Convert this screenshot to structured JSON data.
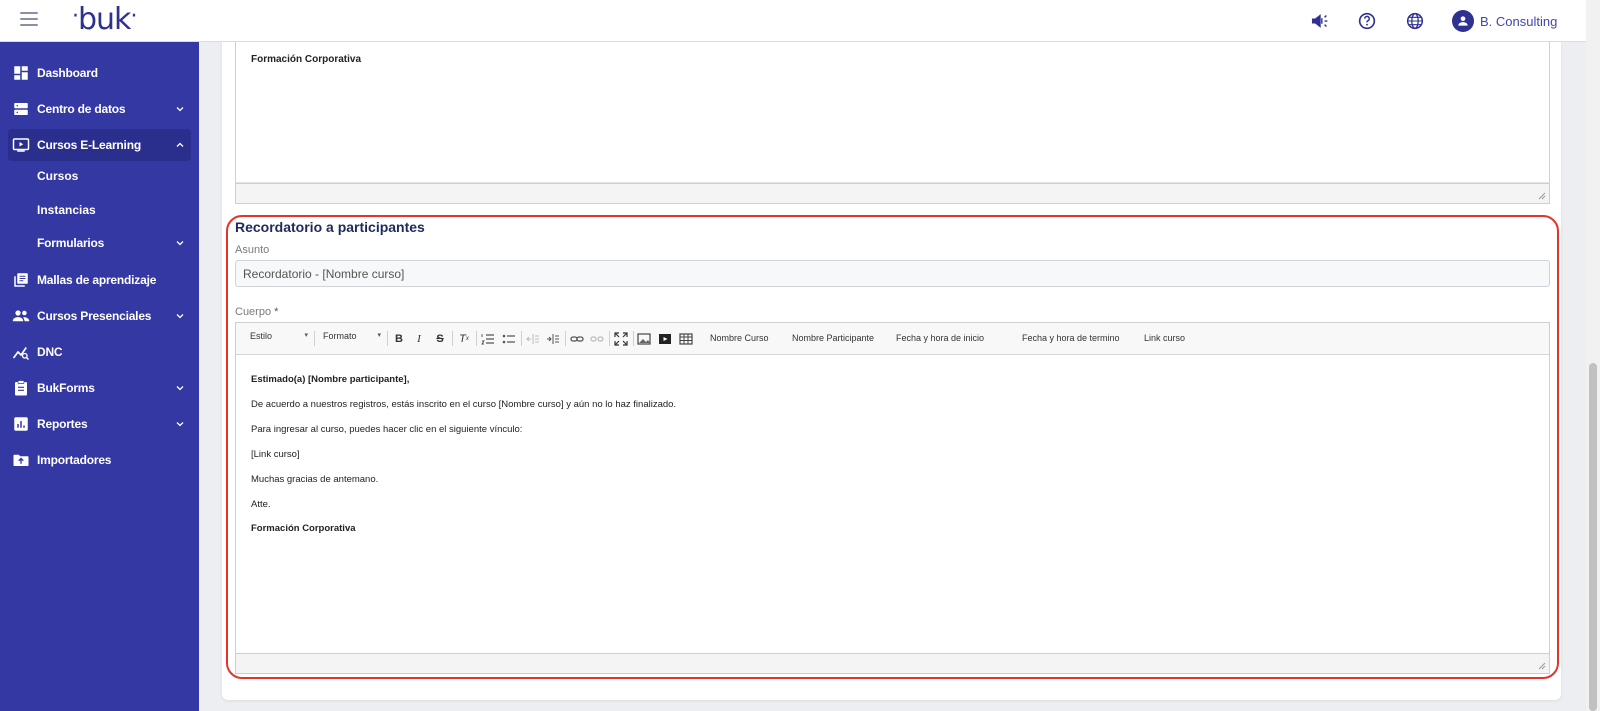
{
  "header": {
    "logo_text": "buk",
    "user_name": "B. Consulting",
    "icons": [
      "announcement-icon",
      "help-icon",
      "language-icon",
      "user-avatar-icon"
    ]
  },
  "sidebar": {
    "items": [
      {
        "label": "Dashboard",
        "icon": "dashboard-icon",
        "has_chevron": false
      },
      {
        "label": "Centro de datos",
        "icon": "database-icon",
        "has_chevron": true
      },
      {
        "label": "Cursos E-Learning",
        "icon": "video-icon",
        "has_chevron": true,
        "active": true
      },
      {
        "label": "Mallas de aprendizaje",
        "icon": "library-icon",
        "has_chevron": false
      },
      {
        "label": "Cursos Presenciales",
        "icon": "people-icon",
        "has_chevron": true
      },
      {
        "label": "DNC",
        "icon": "chart-line-icon",
        "has_chevron": false
      },
      {
        "label": "BukForms",
        "icon": "clipboard-icon",
        "has_chevron": true
      },
      {
        "label": "Reportes",
        "icon": "bar-chart-icon",
        "has_chevron": true
      },
      {
        "label": "Importadores",
        "icon": "folder-upload-icon",
        "has_chevron": false
      }
    ],
    "sub_items": [
      "Cursos",
      "Instancias",
      "Formularios"
    ]
  },
  "previous_editor": {
    "text": "Formación Corporativa"
  },
  "reminder": {
    "title": "Recordatorio a participantes",
    "subject_label": "Asunto",
    "subject_value": "Recordatorio - [Nombre curso]",
    "body_label": "Cuerpo",
    "required_mark": "*",
    "toolbar": {
      "style_label": "Estilo",
      "format_label": "Formato",
      "placeholders": [
        "Nombre Curso",
        "Nombre Participante",
        "Fecha y hora de inicio",
        "Fecha y hora de termino",
        "Link curso"
      ]
    },
    "body_lines": [
      "Estimado(a) [Nombre participante],",
      "De acuerdo a nuestros registros, estás inscrito en el curso [Nombre curso] y aún no lo haz finalizado.",
      "Para ingresar al curso, puedes hacer clic en el siguiente vínculo:",
      "[Link curso]",
      "Muchas gracias de antemano.",
      "Atte.",
      "Formación Corporativa"
    ]
  },
  "colors": {
    "sidebar": "#3338a3",
    "brand": "#2e3192",
    "highlight": "#e5332a"
  }
}
